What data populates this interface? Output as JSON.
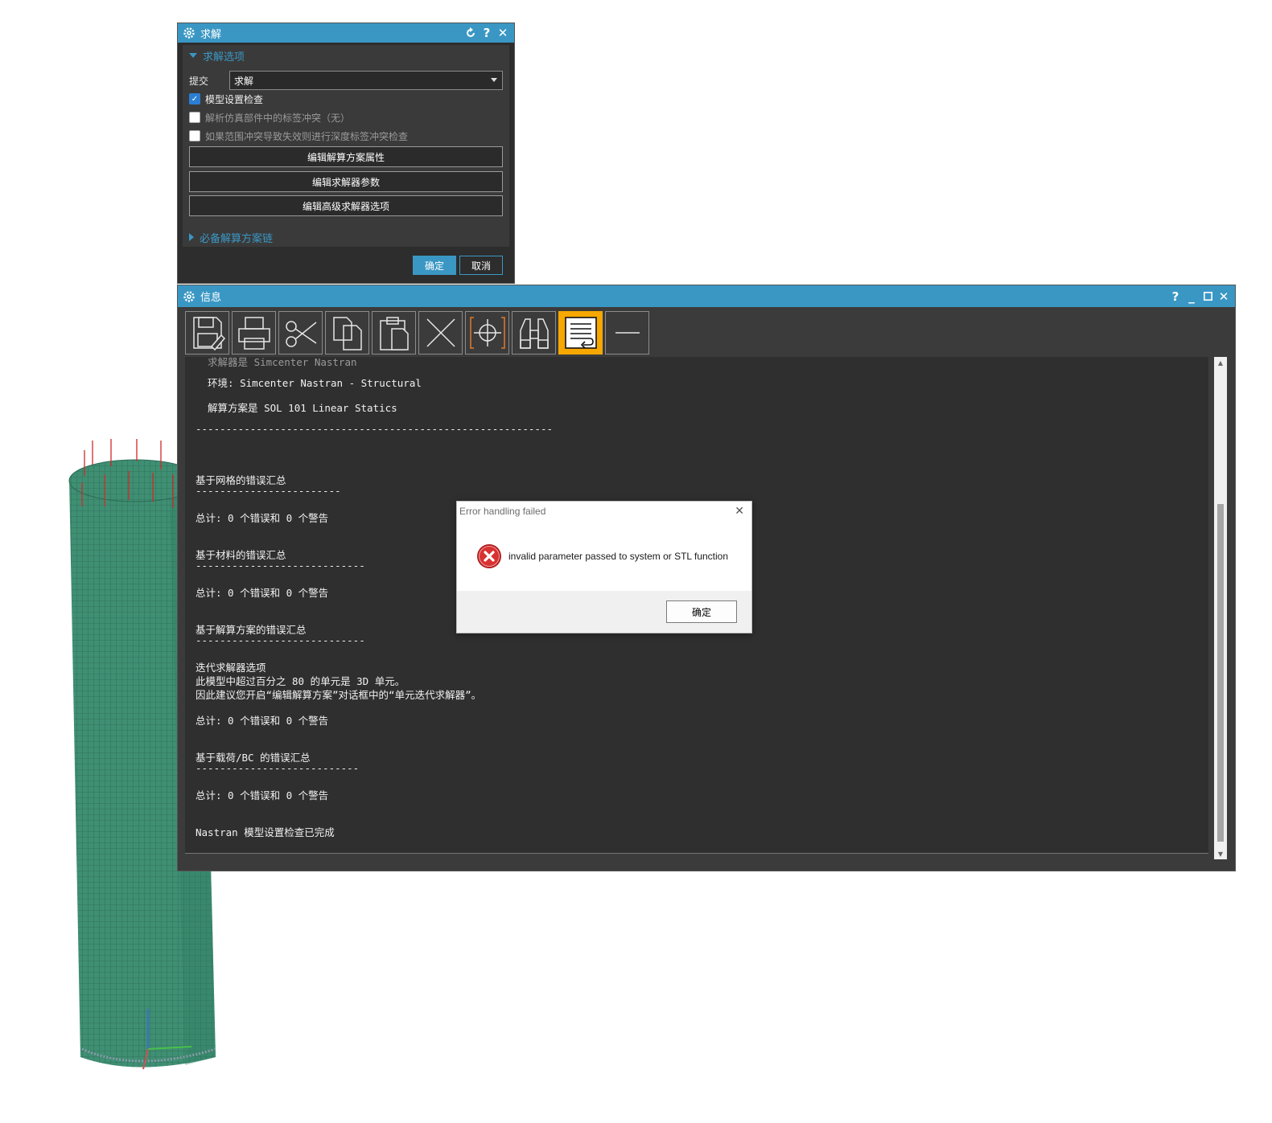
{
  "solve_dialog": {
    "title": "求解",
    "section_title": "求解选项",
    "submit_label": "提交",
    "submit_value": "求解",
    "checkboxes": [
      {
        "label": "模型设置检查",
        "checked": true
      },
      {
        "label": "解析仿真部件中的标签冲突（无）",
        "checked": false
      },
      {
        "label": "如果范围冲突导致失效则进行深度标签冲突检查",
        "checked": false
      }
    ],
    "buttons": [
      "编辑解算方案属性",
      "编辑求解器参数",
      "编辑高级求解器选项"
    ],
    "collapsed_section": "必备解算方案链",
    "ok_label": "确定",
    "cancel_label": "取消",
    "accent_color": "#3a97c4"
  },
  "info_window": {
    "title": "信息",
    "toolbar": [
      "save-icon",
      "print-icon",
      "cut-icon",
      "copy-icon",
      "paste-icon",
      "clear-icon",
      "target-icon",
      "binoculars-icon",
      "word-wrap-icon",
      "minimize-line-icon"
    ],
    "active_tool": "word-wrap-icon",
    "lines": [
      "  环境: Simcenter Nastran - Structural",
      "  解算方案是 SOL 101 Linear Statics",
      "-----------------------------------------------------------",
      "基于网格的错误汇总",
      "------------------------",
      "总计: 0 个错误和 0 个警告",
      "基于材料的错误汇总",
      "----------------------------",
      "总计: 0 个错误和 0 个警告",
      "基于解算方案的错误汇总",
      "----------------------------",
      "迭代求解器选项",
      "此模型中超过百分之 80 的单元是 3D 单元。",
      "因此建议您开启“编辑解算方案”对话框中的“单元迭代求解器”。",
      "总计: 0 个错误和 0 个警告",
      "基于载荷/BC 的错误汇总",
      "---------------------------",
      "总计: 0 个错误和 0 个警告",
      "Nastran 模型设置检查已完成"
    ]
  },
  "error_dialog": {
    "title": "Error handling failed",
    "message": "invalid parameter passed to system or STL function",
    "ok_label": "确定",
    "icon": "error-icon"
  }
}
